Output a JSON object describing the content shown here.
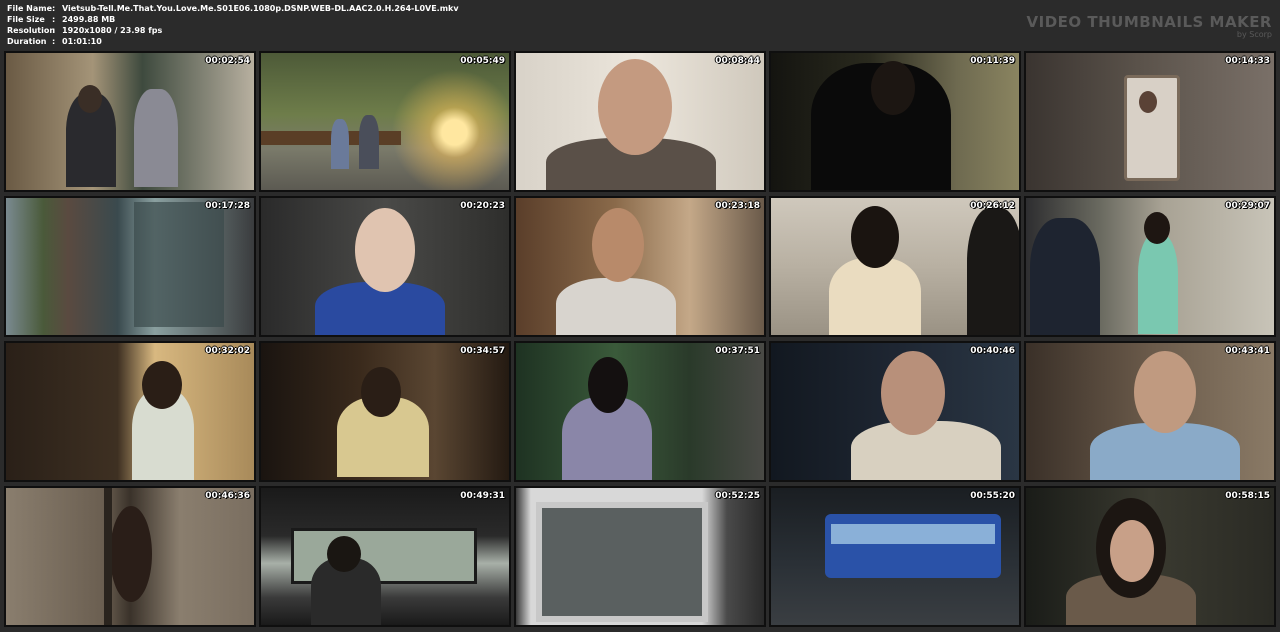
{
  "file_info": {
    "file_name_label": "File Name",
    "file_name": "Vietsub-Tell.Me.That.You.Love.Me.S01E06.1080p.DSNP.WEB-DL.AAC2.0.H.264-L0VE.mkv",
    "file_size_label": "File Size",
    "file_size": "2499.88 MB",
    "resolution_label": "Resolution",
    "resolution": "1920x1080 / 23.98 fps",
    "duration_label": "Duration",
    "duration": "01:01:10",
    "separator": ":"
  },
  "brand": {
    "title": "VIDEO THUMBNAILS MAKER",
    "subtitle": "by Scorp"
  },
  "thumbnails": [
    {
      "timestamp": "00:02:54",
      "scene": "art-classroom"
    },
    {
      "timestamp": "00:05:49",
      "scene": "park-bench-sunset"
    },
    {
      "timestamp": "00:08:44",
      "scene": "man-closeup"
    },
    {
      "timestamp": "00:11:39",
      "scene": "man-painting-wall"
    },
    {
      "timestamp": "00:14:33",
      "scene": "phone-video-call"
    },
    {
      "timestamp": "00:17:28",
      "scene": "building-sign"
    },
    {
      "timestamp": "00:20:23",
      "scene": "woman-blue-hoodie"
    },
    {
      "timestamp": "00:23:18",
      "scene": "young-man-smiling"
    },
    {
      "timestamp": "00:26:12",
      "scene": "woman-cream-blouse"
    },
    {
      "timestamp": "00:29:07",
      "scene": "woman-mint-shirt"
    },
    {
      "timestamp": "00:32:02",
      "scene": "woman-doorway"
    },
    {
      "timestamp": "00:34:57",
      "scene": "man-dark-room"
    },
    {
      "timestamp": "00:37:51",
      "scene": "woman-night-trees"
    },
    {
      "timestamp": "00:40:46",
      "scene": "man-smiling-night"
    },
    {
      "timestamp": "00:43:41",
      "scene": "man-blue-shirt"
    },
    {
      "timestamp": "00:46:36",
      "scene": "woman-behind-door"
    },
    {
      "timestamp": "00:49:31",
      "scene": "car-interior"
    },
    {
      "timestamp": "00:52:25",
      "scene": "monitor-set"
    },
    {
      "timestamp": "00:55:20",
      "scene": "blue-bus-night"
    },
    {
      "timestamp": "00:58:15",
      "scene": "woman-night-closeup"
    }
  ]
}
